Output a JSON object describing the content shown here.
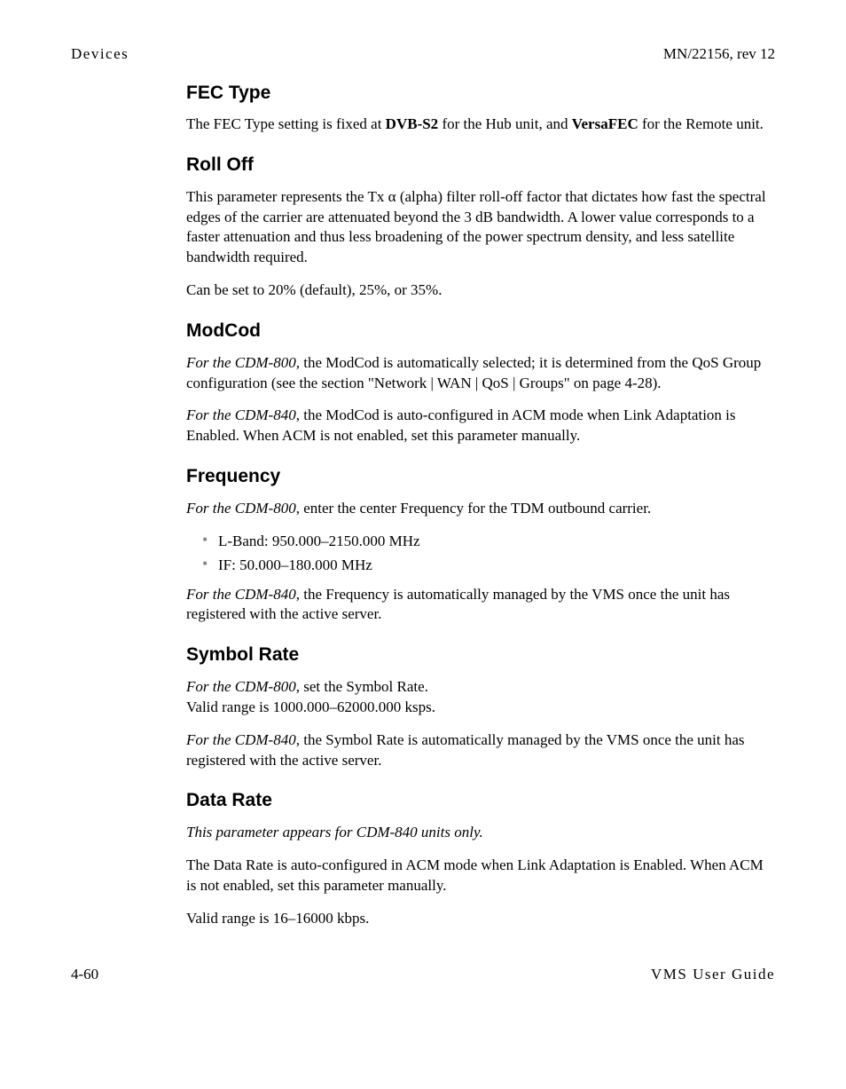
{
  "header": {
    "left": "Devices",
    "right": "MN/22156, rev 12"
  },
  "sections": {
    "fec_type": {
      "heading": "FEC Type",
      "p1_pre": "The FEC Type setting is fixed at ",
      "p1_bold1": "DVB-S2",
      "p1_mid": " for the Hub unit, and ",
      "p1_bold2": "VersaFEC",
      "p1_post": " for the Remote unit."
    },
    "roll_off": {
      "heading": "Roll Off",
      "p1": "This parameter represents the Tx α (alpha) filter roll-off factor that dictates how fast the spectral edges of the carrier are attenuated beyond the 3 dB bandwidth. A lower value corresponds to a faster attenuation and thus less broadening of the power spectrum density, and less satellite bandwidth required.",
      "p2": "Can be set to 20% (default), 25%, or 35%."
    },
    "modcod": {
      "heading": "ModCod",
      "p1_em": "For the CDM-800",
      "p1_rest": ", the ModCod is automatically selected; it is determined from the QoS Group configuration (see the section \"Network | WAN | QoS | Groups\" on page 4-28).",
      "p2_em": "For the CDM-840",
      "p2_rest": ", the ModCod is auto-configured in ACM mode when Link Adaptation is Enabled. When ACM is not enabled, set this parameter manually."
    },
    "frequency": {
      "heading": "Frequency",
      "p1_em": "For the CDM-800",
      "p1_rest": ", enter the center Frequency for the TDM outbound carrier.",
      "li1": "L-Band: 950.000–2150.000 MHz",
      "li2": "IF: 50.000–180.000 MHz",
      "p2_em": "For the CDM-840",
      "p2_rest": ", the Frequency is automatically managed by the VMS once the unit has registered with the active server."
    },
    "symbol_rate": {
      "heading": "Symbol Rate",
      "p1_em": "For the CDM-800",
      "p1_rest": ", set the Symbol Rate.",
      "p1_line2": "Valid range is 1000.000–62000.000 ksps.",
      "p2_em": "For the CDM-840",
      "p2_rest": ", the Symbol Rate is automatically managed by the VMS once the unit has registered with the active server."
    },
    "data_rate": {
      "heading": "Data Rate",
      "p1_em": "This parameter appears for CDM-840 units only.",
      "p2": "The Data Rate is auto-configured in ACM mode when Link Adaptation is Enabled. When ACM is not enabled, set this parameter manually.",
      "p3": "Valid range is 16–16000 kbps."
    }
  },
  "footer": {
    "left": "4-60",
    "right": "VMS User Guide"
  }
}
